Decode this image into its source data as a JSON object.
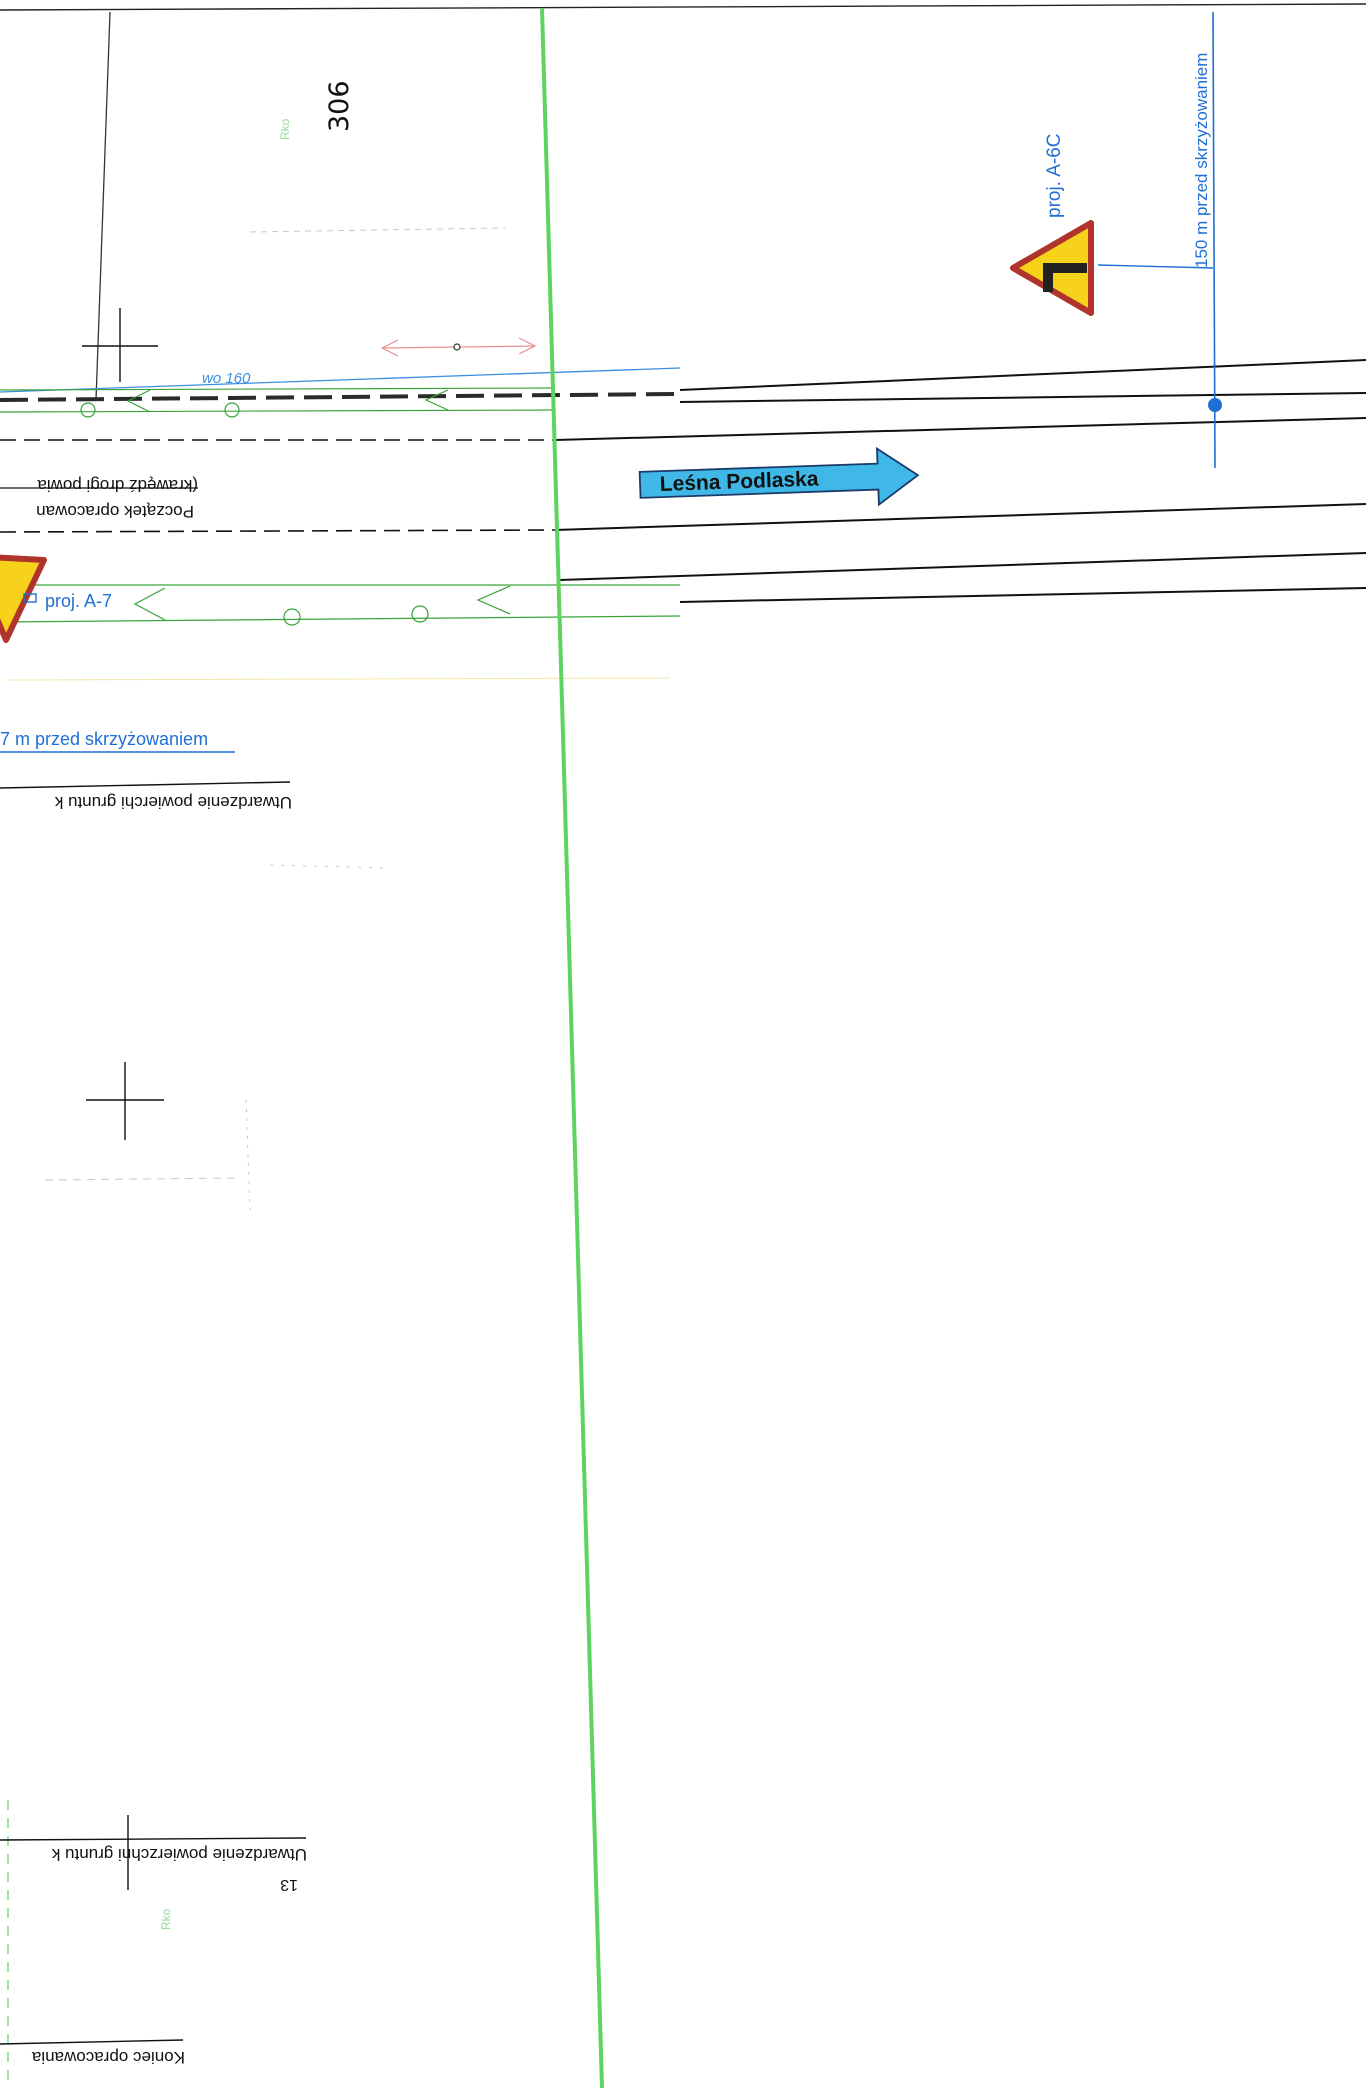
{
  "plan": {
    "number": "306",
    "small_mark": "Rko"
  },
  "signs": {
    "a6c_label": "proj. A-6C",
    "a6c_distance": "150 m przed skrzyżowaniem",
    "a7_label": "proj. A-7",
    "a7_distance": "7 m przed skrzyżowaniem"
  },
  "direction": {
    "destination": "Leśna Podlaska",
    "color": "#3fb8e8"
  },
  "annotations": {
    "pipe": "wo 160",
    "edge_note": "(krawędź drogi powia",
    "start_note": "Początek opracowan",
    "hardening_1": "Utwardzenie powierchi gruntu k",
    "hardening_2": "Utwardzenie powierzchni gruntu k",
    "end_note": "Koniec opracowania",
    "chainage": "13"
  },
  "colors": {
    "survey_line": "#5fd35f",
    "callout": "#1f6fd6",
    "sign_yellow": "#f6d21b",
    "sign_border": "#b0342c",
    "hedge": "#3aa33a"
  }
}
